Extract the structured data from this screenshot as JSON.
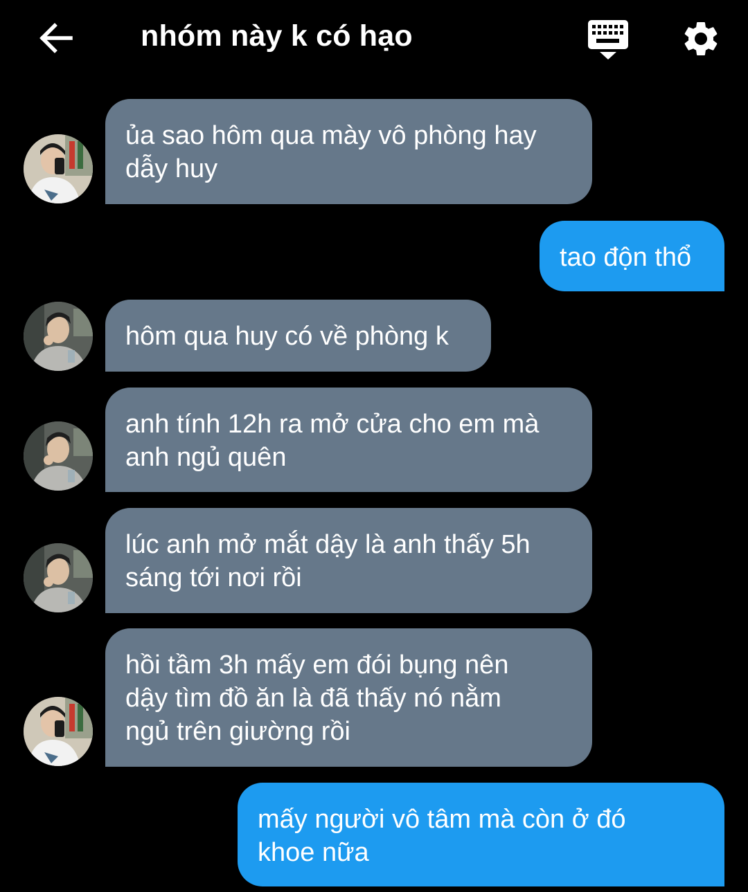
{
  "header": {
    "title": "nhóm này k có hạo",
    "back_icon": "arrow-left-icon",
    "keyboard_icon": "keyboard-icon",
    "settings_icon": "gear-icon"
  },
  "colors": {
    "background": "#000000",
    "incoming_bubble": "#66788a",
    "outgoing_bubble": "#1d9bf0",
    "text": "#ffffff"
  },
  "messages": [
    {
      "direction": "incoming",
      "avatar": "person-a",
      "lines": [
        "ủa sao hôm qua mày vô phòng hay",
        "dẫy huy"
      ]
    },
    {
      "direction": "outgoing",
      "lines": [
        "tao độn thổ"
      ]
    },
    {
      "direction": "incoming",
      "avatar": "person-b",
      "lines": [
        "hôm qua huy có về phòng k"
      ]
    },
    {
      "direction": "incoming",
      "avatar": "person-b",
      "lines": [
        "anh tính 12h ra mở cửa cho em mà",
        "anh ngủ quên"
      ]
    },
    {
      "direction": "incoming",
      "avatar": "person-b",
      "lines": [
        "lúc anh mở mắt dậy là anh thấy 5h",
        "sáng tới nơi rồi"
      ]
    },
    {
      "direction": "incoming",
      "avatar": "person-a",
      "lines": [
        "hồi tầm 3h mấy em đói bụng nên",
        "dậy tìm đồ ăn là đã thấy nó nằm",
        "ngủ trên giường rồi"
      ]
    },
    {
      "direction": "outgoing",
      "lines": [
        "mấy người vô tâm mà còn ở đó",
        "khoe nữa"
      ]
    }
  ]
}
